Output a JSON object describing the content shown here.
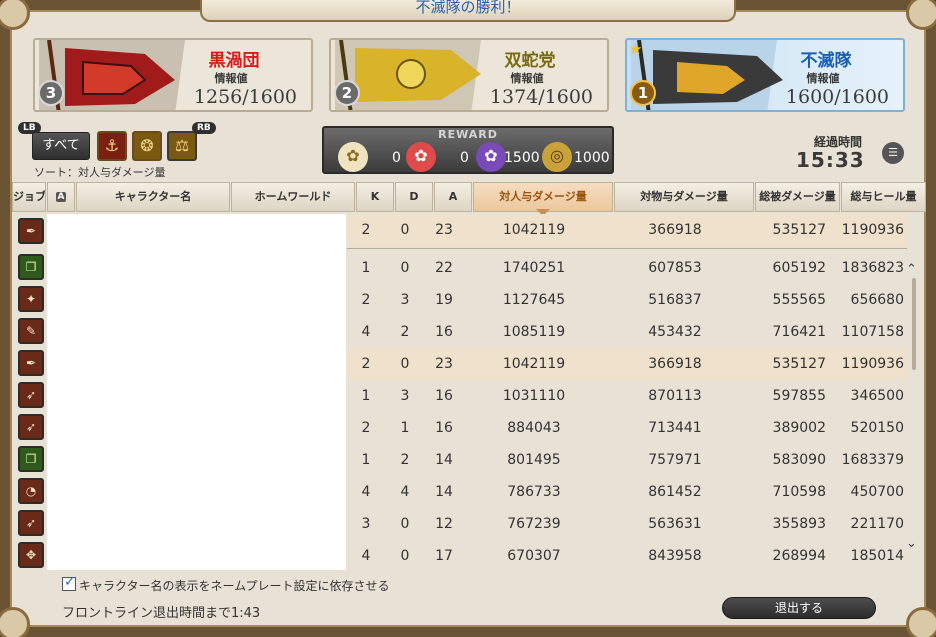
{
  "title": "不滅隊の勝利！",
  "grand_companies": [
    {
      "name": "黒渦団",
      "name_color": "#d81a1a",
      "info_label": "情報値",
      "score": "1256/1600",
      "rank": "3"
    },
    {
      "name": "双蛇党",
      "name_color": "#7a6a10",
      "info_label": "情報値",
      "score": "1374/1600",
      "rank": "2"
    },
    {
      "name": "不滅隊",
      "name_color": "#1a5fb8",
      "info_label": "情報値",
      "score": "1600/1600",
      "rank": "1",
      "winner": true
    }
  ],
  "filter": {
    "lb": "LB",
    "rb": "RB",
    "all_label": "すべて",
    "sort_label": "ソート：対人与ダメージ量"
  },
  "reward": {
    "title": "REWARD",
    "values": [
      "0",
      "0",
      "1500",
      "1000"
    ]
  },
  "elapsed": {
    "label": "経過時間",
    "time": "15:33"
  },
  "table": {
    "headers": [
      "ジョブ",
      "A",
      "キャラクター名",
      "ホームワールド",
      "K",
      "D",
      "A",
      "対人与ダメージ量",
      "対物与ダメージ量",
      "総被ダメージ量",
      "総与ヒール量"
    ],
    "pinned_row": {
      "k": "2",
      "d": "0",
      "a": "23",
      "pvp": "1042119",
      "obj": "366918",
      "taken": "535127",
      "heal": "1190936"
    },
    "rows": [
      {
        "k": "1",
        "d": "0",
        "a": "22",
        "pvp": "1740251",
        "obj": "607853",
        "taken": "605192",
        "heal": "1836823"
      },
      {
        "k": "2",
        "d": "3",
        "a": "19",
        "pvp": "1127645",
        "obj": "516837",
        "taken": "555565",
        "heal": "656680"
      },
      {
        "k": "4",
        "d": "2",
        "a": "16",
        "pvp": "1085119",
        "obj": "453432",
        "taken": "716421",
        "heal": "1107158"
      },
      {
        "k": "2",
        "d": "0",
        "a": "23",
        "pvp": "1042119",
        "obj": "366918",
        "taken": "535127",
        "heal": "1190936"
      },
      {
        "k": "1",
        "d": "3",
        "a": "16",
        "pvp": "1031110",
        "obj": "870113",
        "taken": "597855",
        "heal": "346500"
      },
      {
        "k": "2",
        "d": "1",
        "a": "16",
        "pvp": "884043",
        "obj": "713441",
        "taken": "389002",
        "heal": "520150"
      },
      {
        "k": "1",
        "d": "2",
        "a": "14",
        "pvp": "801495",
        "obj": "757971",
        "taken": "583090",
        "heal": "1683379"
      },
      {
        "k": "4",
        "d": "4",
        "a": "14",
        "pvp": "786733",
        "obj": "861452",
        "taken": "710598",
        "heal": "450700"
      },
      {
        "k": "3",
        "d": "0",
        "a": "12",
        "pvp": "767239",
        "obj": "563631",
        "taken": "355893",
        "heal": "221170"
      },
      {
        "k": "4",
        "d": "0",
        "a": "17",
        "pvp": "670307",
        "obj": "843958",
        "taken": "268994",
        "heal": "185014"
      }
    ]
  },
  "footer": {
    "checkbox_label": "キャラクター名の表示をネームプレート設定に依存させる",
    "exit_time": "フロントライン退出時間まで1:43",
    "exit_button": "退出する"
  }
}
